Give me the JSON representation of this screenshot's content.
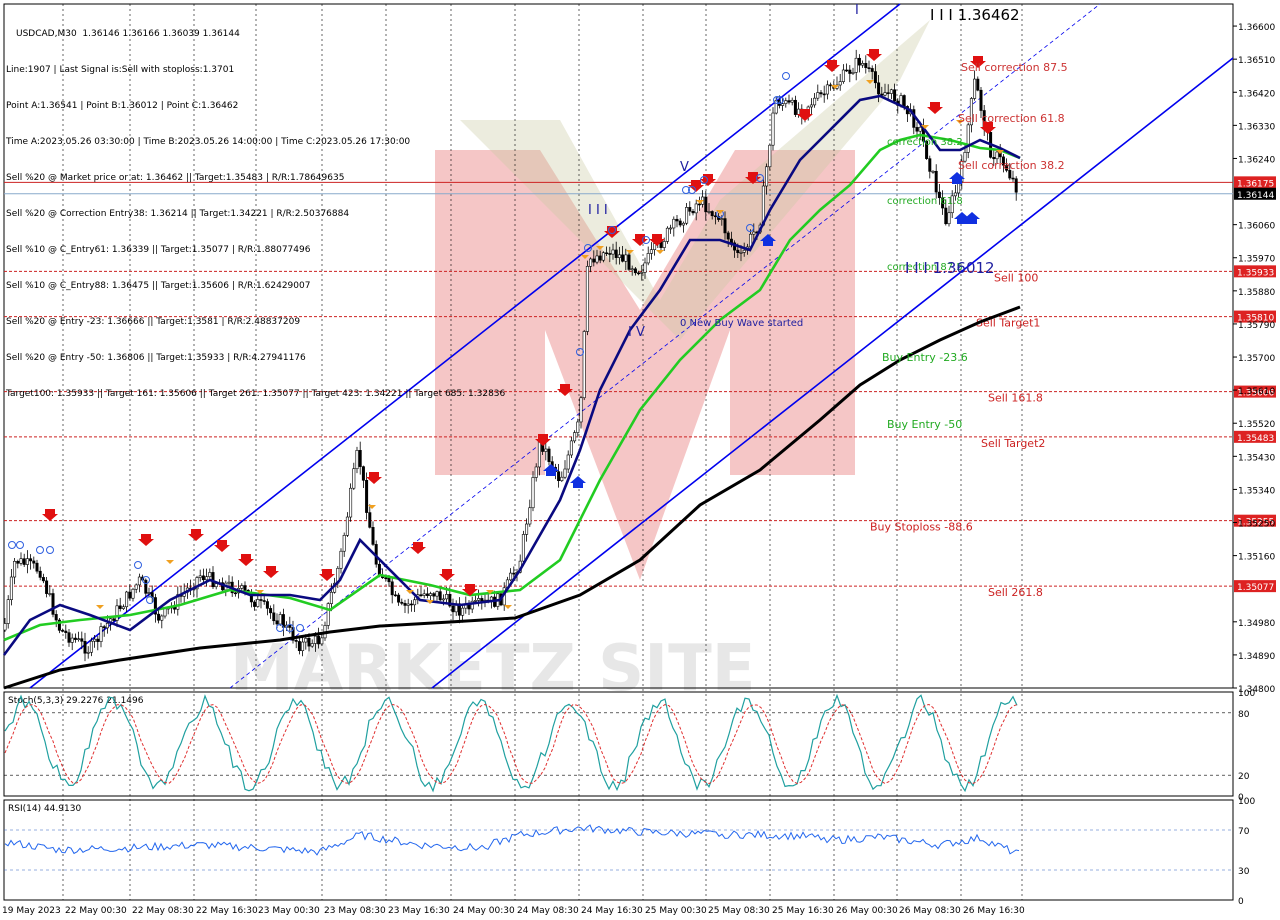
{
  "header": {
    "symbol_line": "USDCAD,M30  1.36146 1.36166 1.36039 1.36144",
    "lines": [
      "Line:1907 | Last Signal is:Sell with stoploss:1.3701",
      "Point A:1.36541 | Point B:1.36012 | Point C:1.36462",
      "Time A:2023.05.26 03:30:00 | Time B:2023.05.26 14:00:00 | Time C:2023.05.26 17:30:00",
      "Sell %20 @ Market price or at: 1.36462 || Target:1.35483 | R/R:1.78649635",
      "Sell %20 @ Correction Entry38: 1.36214 || Target:1.34221 | R/R:2.50376884",
      "Sell %10 @ C_Entry61: 1.36339 || Target:1.35077 | R/R:1.88077496",
      "Sell %10 @ C_Entry88: 1.36475 || Target:1.35606 | R/R:1.62429007",
      "Sell %20 @ Entry -23: 1.36666 || Target:1.3581 | R/R:2.48837209",
      "Sell %20 @ Entry -50: 1.36806 || Target:1.35933 | R/R:4.27941176",
      "Target100: 1.35933 || Target 161: 1.35606 || Target 261: 1.35077 || Target 423: 1.34221 || Target 685: 1.32836"
    ]
  },
  "colors": {
    "background": "#ffffff",
    "ma_fast": "#0a0a80",
    "ma_mid": "#22cc22",
    "ma_slow": "#000000",
    "channel": "#0000ee",
    "level_line": "#cc2222",
    "level_label": "#cc2222",
    "price_current_bg": "#000000",
    "price_red_bg": "#dd2222",
    "watermark": "#e88080"
  },
  "chart_data": {
    "type": "candlestick",
    "symbol": "USDCAD",
    "timeframe": "M30",
    "price_axis": {
      "ylim": [
        1.348,
        1.3666
      ],
      "ticks": [
        "1.36600",
        "1.36510",
        "1.36420",
        "1.36330",
        "1.36240",
        "1.36060",
        "1.35970",
        "1.35880",
        "1.35790",
        "1.35700",
        "1.35610",
        "1.35520",
        "1.35430",
        "1.35340",
        "1.35250",
        "1.35160",
        "1.34980",
        "1.34890",
        "1.34800"
      ]
    },
    "time_axis": {
      "ticks": [
        "19 May 2023",
        "22 May 00:30",
        "22 May 08:30",
        "22 May 16:30",
        "23 May 00:30",
        "23 May 08:30",
        "23 May 16:30",
        "24 May 00:30",
        "24 May 08:30",
        "24 May 16:30",
        "25 May 00:30",
        "25 May 08:30",
        "25 May 16:30",
        "26 May 00:30",
        "26 May 08:30",
        "26 May 16:30"
      ]
    },
    "levels": [
      {
        "price": 1.36175,
        "tag": "1.36175",
        "label": "",
        "style": "solid-red"
      },
      {
        "price": 1.36144,
        "tag": "1.36144",
        "label": "",
        "style": "current"
      },
      {
        "price": 1.35933,
        "tag": "1.35933",
        "label": "Sell 100",
        "style": "dashed"
      },
      {
        "price": 1.3581,
        "tag": "1.35810",
        "label": "Sell Target1",
        "style": "dashed"
      },
      {
        "price": 1.35606,
        "tag": "1.35606",
        "label": "Sell 161.8",
        "style": "dashed"
      },
      {
        "price": 1.35483,
        "tag": "1.35483",
        "label": "Sell Target2",
        "style": "dashed"
      },
      {
        "price": 1.35255,
        "tag": "1.35255",
        "label": "Buy Stoploss -88.6",
        "style": "dashed"
      },
      {
        "price": 1.35077,
        "tag": "1.35077",
        "label": "Sell  261.8",
        "style": "dashed"
      }
    ],
    "annotations": [
      {
        "text": "Sell correction 87.5"
      },
      {
        "text": "Sell correction 61.8"
      },
      {
        "text": "Sell correction 38.2"
      },
      {
        "text": "correction 38.2"
      },
      {
        "text": "correction 61.8"
      },
      {
        "text": "correction 87.5"
      },
      {
        "text": "Buy Entry -23.6"
      },
      {
        "text": "Buy Entry -50"
      },
      {
        "text": "0 New Buy Wave started"
      },
      {
        "text": "I I I 1.36462"
      },
      {
        "text": "I I I 1.36012"
      },
      {
        "text": "I I I"
      },
      {
        "text": "I V"
      },
      {
        "text": "V"
      },
      {
        "text": "I"
      }
    ],
    "indicators": [
      {
        "name": "Stoch(5,3,3)",
        "label": "Stoch(5,3,3) 29.2276 21.1496",
        "ylim": [
          0,
          100
        ],
        "ticks": [
          "100",
          "80",
          "20",
          "0"
        ],
        "levels": [
          80,
          20
        ]
      },
      {
        "name": "RSI(14)",
        "label": "RSI(14) 44.9130",
        "ylim": [
          0,
          100
        ],
        "ticks": [
          "100",
          "70",
          "30",
          "0"
        ],
        "levels": [
          70,
          30
        ]
      }
    ],
    "watermark": "MARKETZ SITE"
  }
}
